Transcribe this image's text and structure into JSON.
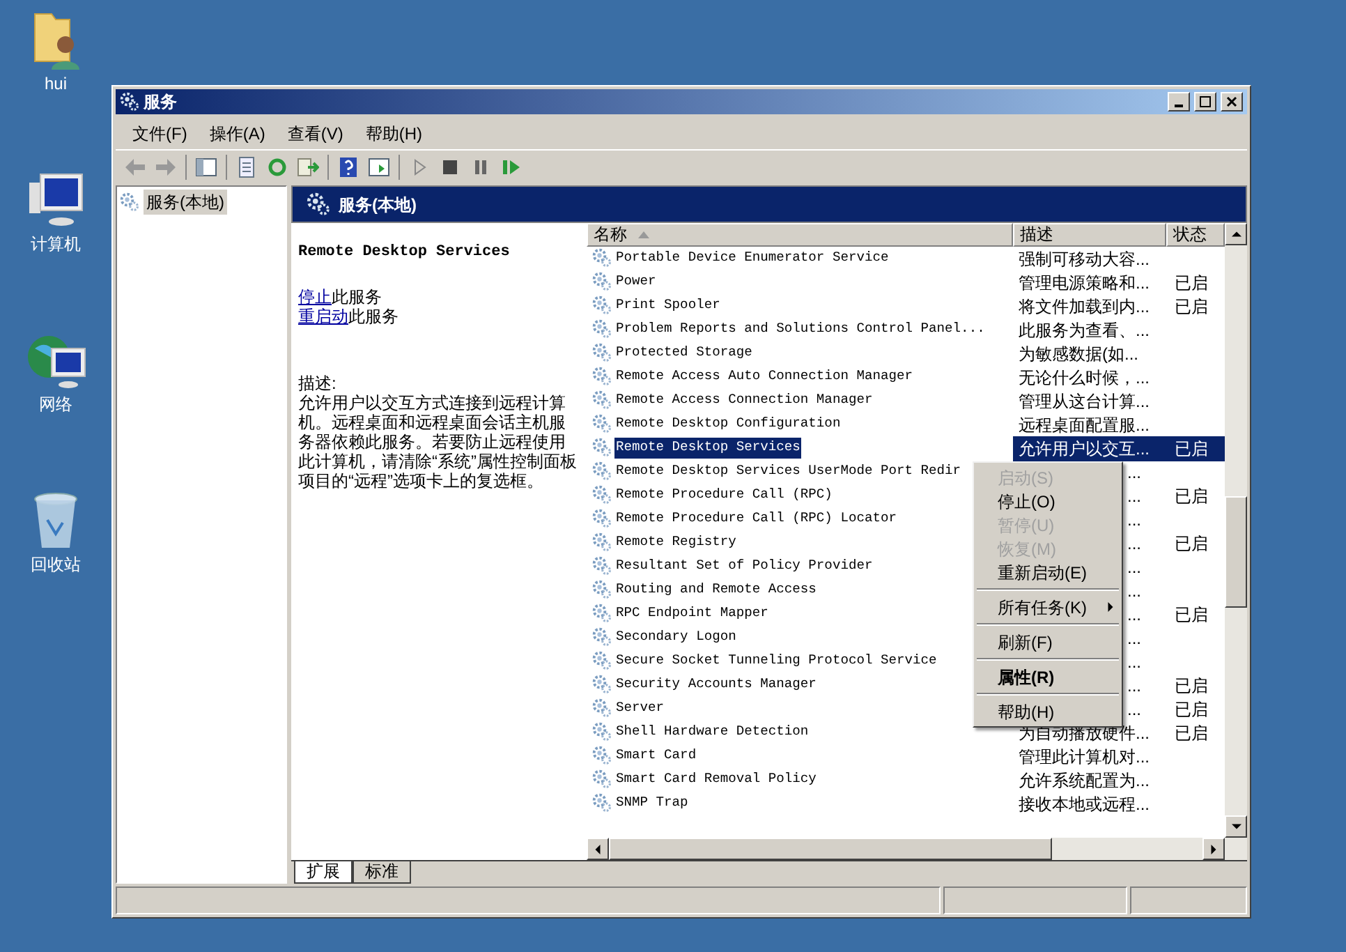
{
  "desktop_icons": [
    {
      "label": "hui",
      "kind": "user-folder"
    },
    {
      "label": "计算机",
      "kind": "computer"
    },
    {
      "label": "网络",
      "kind": "network"
    },
    {
      "label": "回收站",
      "kind": "recycle-bin"
    }
  ],
  "window": {
    "title": "服务"
  },
  "menu_bar": [
    "文件(F)",
    "操作(A)",
    "查看(V)",
    "帮助(H)"
  ],
  "tree": {
    "items": [
      {
        "label": "服务(本地)",
        "selected": true
      }
    ]
  },
  "header": {
    "title": "服务(本地)"
  },
  "details": {
    "service_name": "Remote Desktop Services",
    "actions": [
      {
        "link": "停止",
        "text": "此服务"
      },
      {
        "link": "重启动",
        "text": "此服务"
      }
    ],
    "description_label": "描述:",
    "description": "允许用户以交互方式连接到远程计算机。远程桌面和远程桌面会话主机服务器依赖此服务。若要防止远程使用此计算机，请清除“系统”属性控制面板项目的“远程”选项卡上的复选框。"
  },
  "table": {
    "columns": [
      "名称",
      "描述",
      "状态"
    ],
    "rows": [
      {
        "name": "Portable Device Enumerator Service",
        "description": "强制可移动大容...",
        "status": "",
        "selected": false
      },
      {
        "name": "Power",
        "description": "管理电源策略和...",
        "status": "已启",
        "selected": false
      },
      {
        "name": "Print Spooler",
        "description": "将文件加载到内...",
        "status": "已启",
        "selected": false
      },
      {
        "name": "Problem Reports and Solutions Control Panel...",
        "description": "此服务为查看、...",
        "status": "",
        "selected": false
      },
      {
        "name": "Protected Storage",
        "description": "为敏感数据(如...",
        "status": "",
        "selected": false
      },
      {
        "name": "Remote Access Auto Connection Manager",
        "description": "无论什么时候，...",
        "status": "",
        "selected": false
      },
      {
        "name": "Remote Access Connection Manager",
        "description": "管理从这台计算...",
        "status": "",
        "selected": false
      },
      {
        "name": "Remote Desktop Configuration",
        "description": "远程桌面配置服...",
        "status": "",
        "selected": false
      },
      {
        "name": "Remote Desktop Services",
        "description": "允许用户以交互...",
        "status": "已启",
        "selected": true
      },
      {
        "name": "Remote Desktop Services UserMode Port Redir",
        "description": "...",
        "status": "",
        "selected": false,
        "covered": true
      },
      {
        "name": "Remote Procedure Call (RPC)",
        "description": "...",
        "status": "已启",
        "selected": false,
        "covered": true
      },
      {
        "name": "Remote Procedure Call (RPC) Locator",
        "description": "...",
        "status": "",
        "selected": false,
        "covered": true
      },
      {
        "name": "Remote Registry",
        "description": "...",
        "status": "已启",
        "selected": false,
        "covered": true
      },
      {
        "name": "Resultant Set of Policy Provider",
        "description": "...",
        "status": "",
        "selected": false,
        "covered": true
      },
      {
        "name": "Routing and Remote Access",
        "description": "...",
        "status": "",
        "selected": false,
        "covered": true
      },
      {
        "name": "RPC Endpoint Mapper",
        "description": "...",
        "status": "已启",
        "selected": false,
        "covered": true
      },
      {
        "name": "Secondary Logon",
        "description": "...",
        "status": "",
        "selected": false,
        "covered": true
      },
      {
        "name": "Secure Socket Tunneling Protocol Service",
        "description": "...",
        "status": "",
        "selected": false,
        "covered": true
      },
      {
        "name": "Security Accounts Manager",
        "description": "...",
        "status": "已启",
        "selected": false,
        "covered": true
      },
      {
        "name": "Server",
        "description": "...",
        "status": "已启",
        "selected": false,
        "covered": true
      },
      {
        "name": "Shell Hardware Detection",
        "description": "为自动播放硬件...",
        "status": "已启",
        "selected": false
      },
      {
        "name": "Smart Card",
        "description": "管理此计算机对...",
        "status": "",
        "selected": false
      },
      {
        "name": "Smart Card Removal Policy",
        "description": "允许系统配置为...",
        "status": "",
        "selected": false
      },
      {
        "name": "SNMP Trap",
        "description": "接收本地或远程...",
        "status": "",
        "selected": false
      }
    ]
  },
  "context_menu": [
    {
      "kind": "item",
      "label": "启动(S)",
      "disabled": true
    },
    {
      "kind": "item",
      "label": "停止(O)",
      "disabled": false
    },
    {
      "kind": "item",
      "label": "暂停(U)",
      "disabled": true
    },
    {
      "kind": "item",
      "label": "恢复(M)",
      "disabled": true
    },
    {
      "kind": "item",
      "label": "重新启动(E)",
      "disabled": false
    },
    {
      "kind": "separator"
    },
    {
      "kind": "submenu",
      "label": "所有任务(K)",
      "disabled": false
    },
    {
      "kind": "separator"
    },
    {
      "kind": "item",
      "label": "刷新(F)",
      "disabled": false
    },
    {
      "kind": "separator"
    },
    {
      "kind": "item",
      "label": "属性(R)",
      "disabled": false,
      "default": true
    },
    {
      "kind": "separator"
    },
    {
      "kind": "item",
      "label": "帮助(H)",
      "disabled": false
    }
  ],
  "view_tabs": [
    {
      "label": "扩展",
      "selected": true
    },
    {
      "label": "标准",
      "selected": false
    }
  ]
}
